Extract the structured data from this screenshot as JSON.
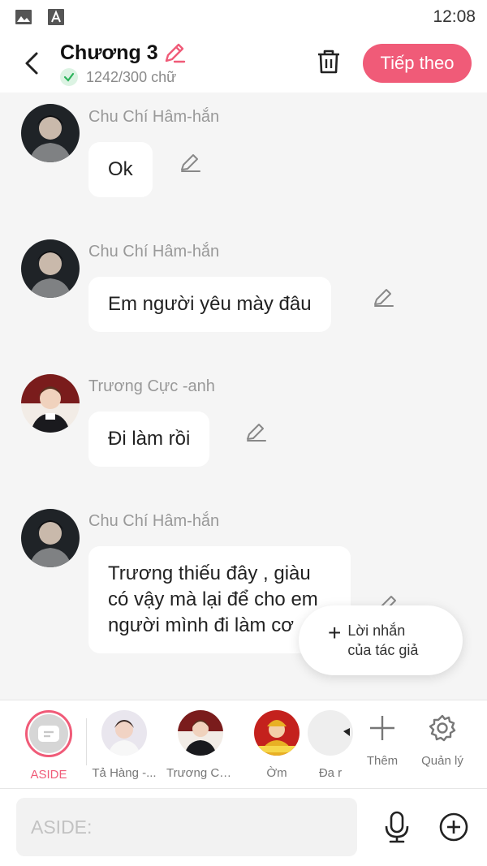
{
  "status_bar": {
    "time": "12:08",
    "icons": [
      "image-icon",
      "font-icon"
    ]
  },
  "header": {
    "title": "Chương 3",
    "word_count": "1242/300 chữ",
    "next_label": "Tiếp theo",
    "icons": [
      "back-arrow-icon",
      "pencil-icon",
      "check-icon",
      "trash-icon"
    ]
  },
  "messages": [
    {
      "sender": "Chu Chí Hâm-hắn",
      "text": "Ok"
    },
    {
      "sender": "Chu Chí Hâm-hắn",
      "text": "Em người yêu mày đâu"
    },
    {
      "sender": "Trương Cực -anh",
      "text": "Đi làm rồi"
    },
    {
      "sender": "Chu Chí Hâm-hắn",
      "text": "Trương thiếu đây , giàu có vậy mà lại để cho em người mình đi làm cơ"
    }
  ],
  "author_note": {
    "line1": "Lời nhắn",
    "line2": "của tác giả"
  },
  "characters": [
    {
      "label": "ASIDE"
    },
    {
      "label": "Tả Hàng -..."
    },
    {
      "label": "Trương Cự..."
    },
    {
      "label": "Ờm"
    },
    {
      "label": "Đa r"
    }
  ],
  "tools": {
    "add_label": "Thêm",
    "manage_label": "Quản lý"
  },
  "composer": {
    "placeholder": "ASIDE:",
    "icons": [
      "microphone-icon",
      "plus-circle-icon"
    ]
  },
  "colors": {
    "accent": "#f05b78",
    "background": "#f5f5f5",
    "bubble": "#ffffff",
    "muted_text": "#999999"
  }
}
